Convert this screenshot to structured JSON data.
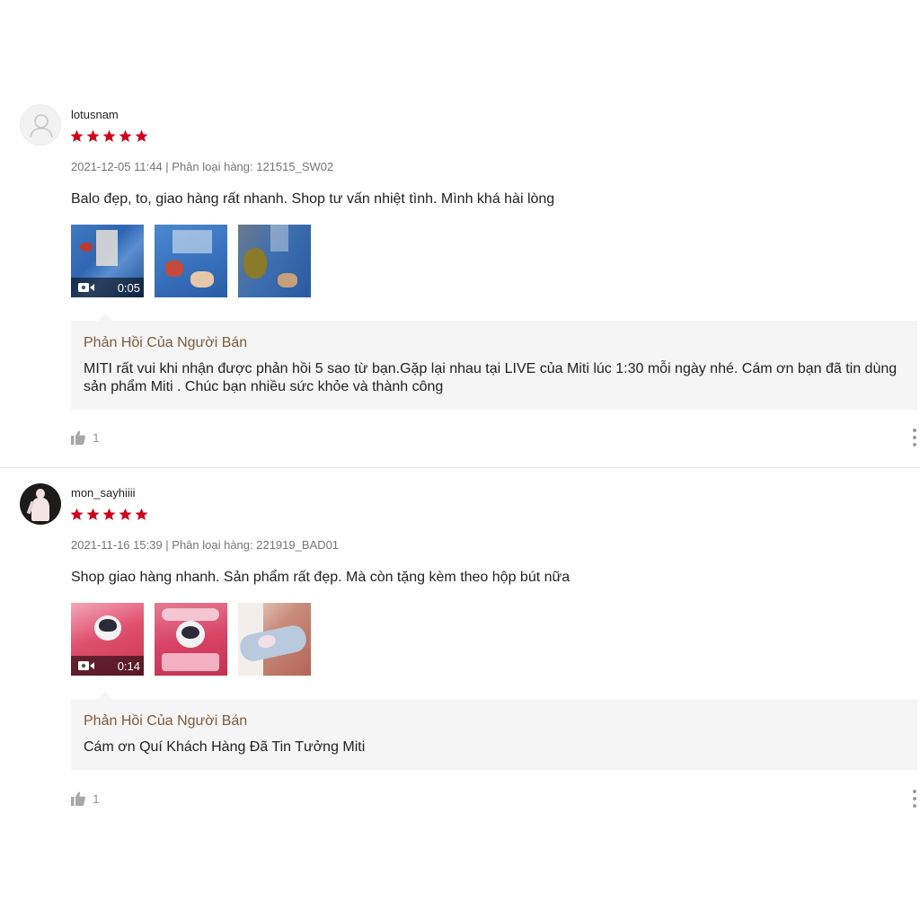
{
  "reviews": [
    {
      "username": "lotusnam",
      "rating": 5,
      "meta": "2021-12-05 11:44 | Phân loại hàng: 121515_SW02",
      "comment": "Balo đẹp, to, giao hàng rất nhanh. Shop tư vấn nhiệt tình. Mình khá hài lòng",
      "video_duration": "0:05",
      "reply_title": "Phản Hồi Của Người Bán",
      "reply_text": "MITI rất vui khi nhận được phản hồi 5 sao từ bạn.Gặp lại nhau tại LIVE của Miti lúc 1:30 mỗi ngày nhé. Cám ơn bạn đã tin dùng sản phẩm Miti . Chúc bạn nhiều sức khỏe và thành công",
      "likes": "1"
    },
    {
      "username": "mon_sayhiiii",
      "rating": 5,
      "meta": "2021-11-16 15:39 | Phân loại hàng: 221919_BAD01",
      "comment": "Shop giao hàng nhanh. Sản phẩm rất đẹp. Mà còn tặng kèm theo hộp bút nữa",
      "video_duration": "0:14",
      "reply_title": "Phản Hồi Của Người Bán",
      "reply_text": "Cám ơn Quí Khách Hàng Đã Tin Tưởng Miti",
      "likes": "1"
    }
  ],
  "colors": {
    "star": "#d0011b",
    "reply_title": "#7d5a3a",
    "reply_bg": "#f5f5f5",
    "meta": "#757575"
  },
  "icons": [
    "default-avatar-icon",
    "star-icon",
    "video-camera-icon",
    "thumbs-up-icon",
    "more-options-icon"
  ]
}
